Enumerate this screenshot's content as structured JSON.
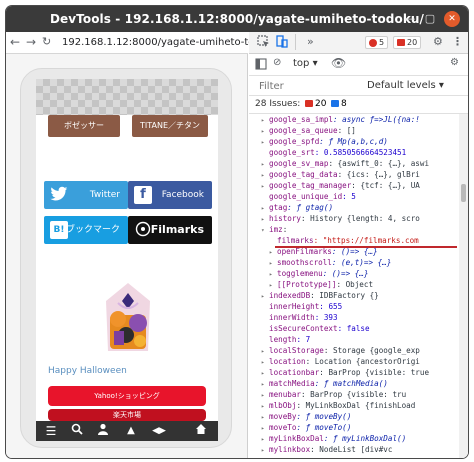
{
  "window": {
    "title": "DevTools - 192.168.1.12:8000/yagate-umiheto-todoku/"
  },
  "browser": {
    "url": "192.168.1.12:8000/yagate-umiheto-todoku/"
  },
  "page": {
    "categories": [
      "ボゼッサー",
      "TITANE／チタン"
    ],
    "social": [
      {
        "icon": "twitter-bird",
        "label": "Twitter",
        "color": "#3a9fdb"
      },
      {
        "icon": "facebook-f",
        "label": "Facebook",
        "color": "#3b5aa0"
      },
      {
        "icon": "B!",
        "label": "ブックマーク",
        "color": "#189ee1"
      },
      {
        "icon": "filmarks",
        "label": "Filmarks",
        "color": "#111111"
      }
    ],
    "halloween_text": "Happy Halloween",
    "buttons": [
      "Yahoo!ショッピング",
      "楽天市場"
    ],
    "button_colors": [
      "#e8142b",
      "#c0101f"
    ]
  },
  "devtools": {
    "more_tabs": "»",
    "error_count": "5",
    "warning_count": "20",
    "context": "top",
    "filter_placeholder": "Filter",
    "levels": "Default levels",
    "issues_label": "28 Issues:",
    "issues_errors": "20",
    "issues_info": "8",
    "lines": [
      {
        "tri": "▸",
        "indent": 0,
        "key": "google_sa_impl",
        "val": ": async ƒ=>JL({na:!",
        "kind": "f"
      },
      {
        "tri": "▸",
        "indent": 0,
        "key": "google_sa_queue",
        "val": ": []",
        "kind": "v"
      },
      {
        "tri": "▸",
        "indent": 0,
        "key": "google_spfd",
        "val": ": ƒ Mp(a,b,c,d)",
        "kind": "f"
      },
      {
        "tri": "",
        "indent": 0,
        "key": "google_srt",
        "val": ": 0.5850566664523451",
        "kind": "n"
      },
      {
        "tri": "▸",
        "indent": 0,
        "key": "google_sv_map",
        "val": ": {aswift_0: {…}, aswi",
        "kind": "v"
      },
      {
        "tri": "▸",
        "indent": 0,
        "key": "google_tag_data",
        "val": ": {ics: {…}, glBri",
        "kind": "v"
      },
      {
        "tri": "▸",
        "indent": 0,
        "key": "google_tag_manager",
        "val": ": {tcf: {…}, UA",
        "kind": "v"
      },
      {
        "tri": "",
        "indent": 0,
        "key": "google_unique_id",
        "val": ": 5",
        "kind": "n"
      },
      {
        "tri": "▸",
        "indent": 0,
        "key": "gtag",
        "val": ": ƒ gtag()",
        "kind": "f"
      },
      {
        "tri": "▸",
        "indent": 0,
        "key": "history",
        "val": ": History {length: 4, scro",
        "kind": "v"
      },
      {
        "tri": "▾",
        "indent": 0,
        "key": "imz",
        "val": ":",
        "kind": "v"
      },
      {
        "tri": "",
        "indent": 1,
        "key": "filmarks",
        "val": ": \"https://filmarks.com",
        "kind": "s"
      },
      {
        "tri": "▸",
        "indent": 1,
        "key": "openFilmarks",
        "val": ": ()=> {…}",
        "kind": "f"
      },
      {
        "tri": "▸",
        "indent": 1,
        "key": "smoothscroll",
        "val": ": (e,t)=> {…}",
        "kind": "f"
      },
      {
        "tri": "▸",
        "indent": 1,
        "key": "togglemenu",
        "val": ": ()=> {…}",
        "kind": "f"
      },
      {
        "tri": "▸",
        "indent": 1,
        "key": "[[Prototype]]",
        "val": ": Object",
        "kind": "v"
      },
      {
        "tri": "▸",
        "indent": 0,
        "key": "indexedDB",
        "val": ": IDBFactory {}",
        "kind": "v"
      },
      {
        "tri": "",
        "indent": 0,
        "key": "innerHeight",
        "val": ": 655",
        "kind": "n"
      },
      {
        "tri": "",
        "indent": 0,
        "key": "innerWidth",
        "val": ": 393",
        "kind": "n"
      },
      {
        "tri": "",
        "indent": 0,
        "key": "isSecureContext",
        "val": ": false",
        "kind": "n"
      },
      {
        "tri": "",
        "indent": 0,
        "key": "length",
        "val": ": 7",
        "kind": "n"
      },
      {
        "tri": "▸",
        "indent": 0,
        "key": "localStorage",
        "val": ": Storage {google_exp",
        "kind": "v"
      },
      {
        "tri": "▸",
        "indent": 0,
        "key": "location",
        "val": ": Location {ancestorOrigi",
        "kind": "v"
      },
      {
        "tri": "▸",
        "indent": 0,
        "key": "locationbar",
        "val": ": BarProp {visible: true",
        "kind": "v"
      },
      {
        "tri": "▸",
        "indent": 0,
        "key": "matchMedia",
        "val": ": ƒ matchMedia()",
        "kind": "f"
      },
      {
        "tri": "▸",
        "indent": 0,
        "key": "menubar",
        "val": ": BarProp {visible: tru",
        "kind": "v"
      },
      {
        "tri": "▸",
        "indent": 0,
        "key": "mlbObj",
        "val": ": MyLinkBoxDal {finishLoad",
        "kind": "v"
      },
      {
        "tri": "▸",
        "indent": 0,
        "key": "moveBy",
        "val": ": ƒ moveBy()",
        "kind": "f"
      },
      {
        "tri": "▸",
        "indent": 0,
        "key": "moveTo",
        "val": ": ƒ moveTo()",
        "kind": "f"
      },
      {
        "tri": "▸",
        "indent": 0,
        "key": "myLinkBoxDal",
        "val": ": ƒ myLinkBoxDal()",
        "kind": "f"
      },
      {
        "tri": "▸",
        "indent": 0,
        "key": "mylinkbox",
        "val": ": NodeList [div#vc",
        "kind": "v"
      }
    ]
  }
}
